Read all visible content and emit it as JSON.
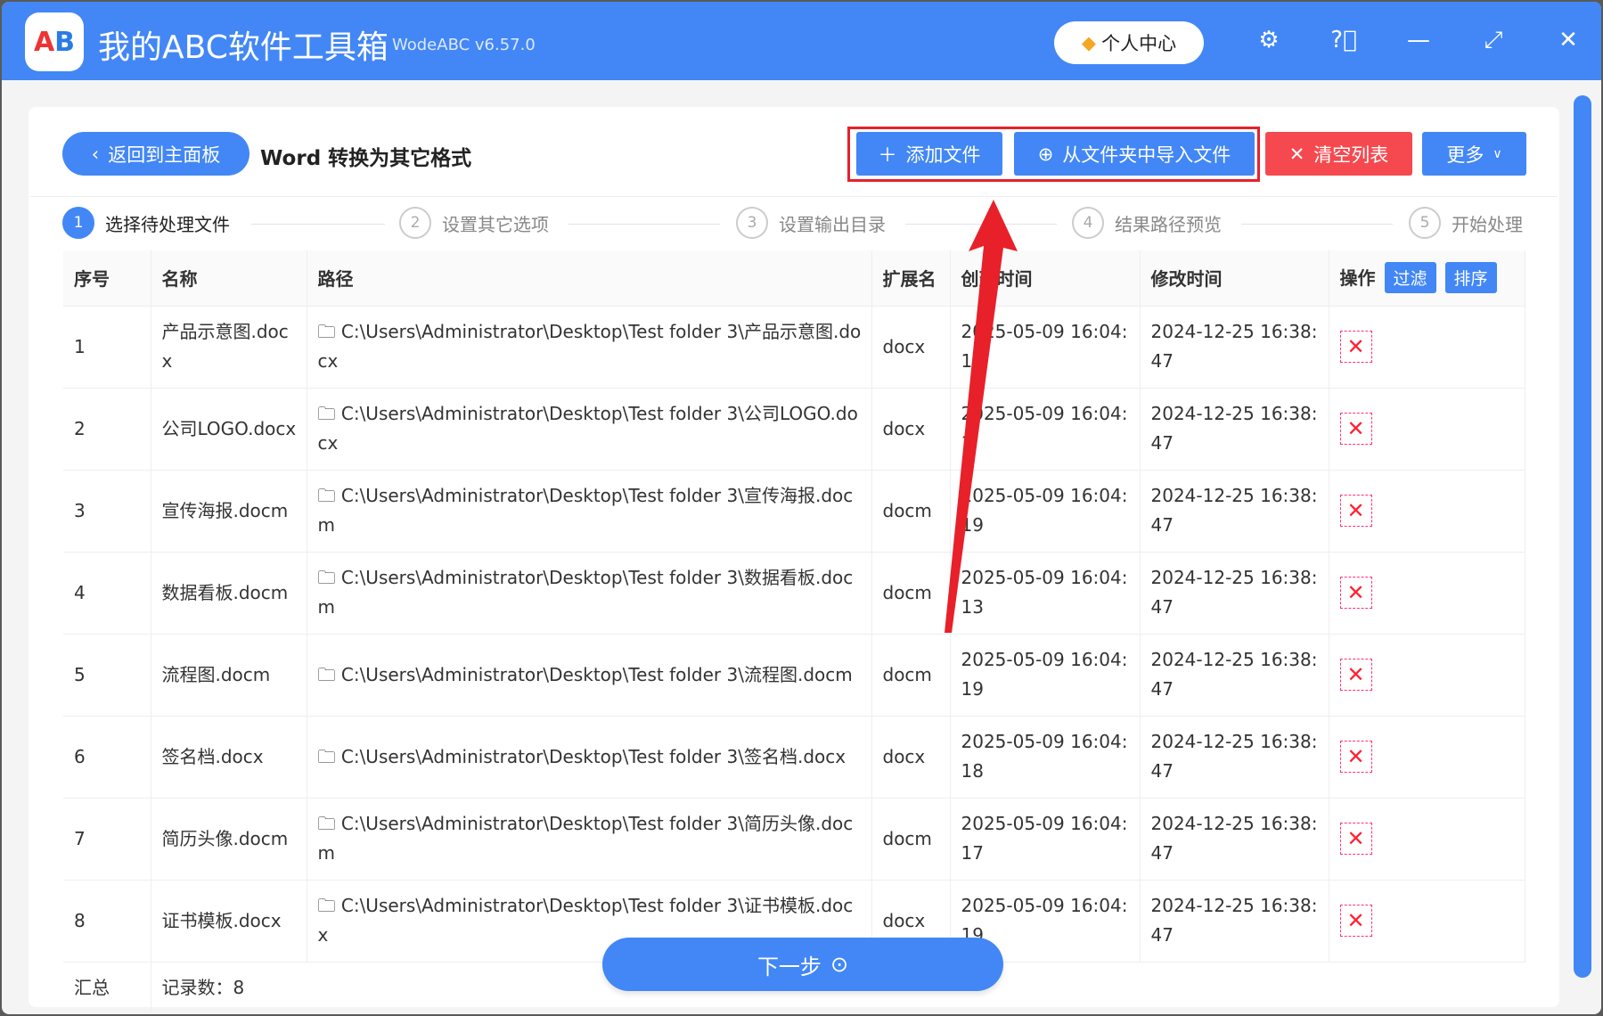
{
  "app": {
    "title": "我的ABC软件工具箱",
    "version": "WodeABC v6.57.0",
    "logo_text": "AB",
    "user_center": "个人中心"
  },
  "toolbar": {
    "back": "返回到主面板",
    "page_title": "Word 转换为其它格式",
    "add_file": "添加文件",
    "import_folder": "从文件夹中导入文件",
    "clear_list": "清空列表",
    "more": "更多"
  },
  "steps": [
    {
      "n": "1",
      "label": "选择待处理文件"
    },
    {
      "n": "2",
      "label": "设置其它选项"
    },
    {
      "n": "3",
      "label": "设置输出目录"
    },
    {
      "n": "4",
      "label": "结果路径预览"
    },
    {
      "n": "5",
      "label": "开始处理"
    }
  ],
  "table": {
    "headers": [
      "序号",
      "名称",
      "路径",
      "扩展名",
      "创建时间",
      "修改时间",
      "操作"
    ],
    "filter": "过滤",
    "sort": "排序",
    "rows": [
      [
        "1",
        "产品示意图.docx",
        "C:\\Users\\Administrator\\Desktop\\Test folder 3\\产品示意图.docx",
        "docx",
        "2025-05-09 16:04:17",
        "2024-12-25 16:38:47"
      ],
      [
        "2",
        "公司LOGO.docx",
        "C:\\Users\\Administrator\\Desktop\\Test folder 3\\公司LOGO.docx",
        "docx",
        "2025-05-09 16:04:1",
        "2024-12-25 16:38:47"
      ],
      [
        "3",
        "宣传海报.docm",
        "C:\\Users\\Administrator\\Desktop\\Test folder 3\\宣传海报.docm",
        "docm",
        "2025-05-09 16:04:19",
        "2024-12-25 16:38:47"
      ],
      [
        "4",
        "数据看板.docm",
        "C:\\Users\\Administrator\\Desktop\\Test folder 3\\数据看板.docm",
        "docm",
        "2025-05-09 16:04:13",
        "2024-12-25 16:38:47"
      ],
      [
        "5",
        "流程图.docm",
        "C:\\Users\\Administrator\\Desktop\\Test folder 3\\流程图.docm",
        "docm",
        "2025-05-09 16:04:19",
        "2024-12-25 16:38:47"
      ],
      [
        "6",
        "签名档.docx",
        "C:\\Users\\Administrator\\Desktop\\Test folder 3\\签名档.docx",
        "docx",
        "2025-05-09 16:04:18",
        "2024-12-25 16:38:47"
      ],
      [
        "7",
        "简历头像.docm",
        "C:\\Users\\Administrator\\Desktop\\Test folder 3\\简历头像.docm",
        "docm",
        "2025-05-09 16:04:17",
        "2024-12-25 16:38:47"
      ],
      [
        "8",
        "证书模板.docx",
        "C:\\Users\\Administrator\\Desktop\\Test folder 3\\证书模板.docx",
        "docx",
        "2025-05-09 16:04:19",
        "2024-12-25 16:38:47"
      ]
    ],
    "summary_label": "汇总",
    "summary_count": "记录数：8"
  },
  "next": "下一步",
  "colors": {
    "accent": "#4287f5",
    "danger": "#f5494f",
    "annotation": "#e8202a"
  }
}
